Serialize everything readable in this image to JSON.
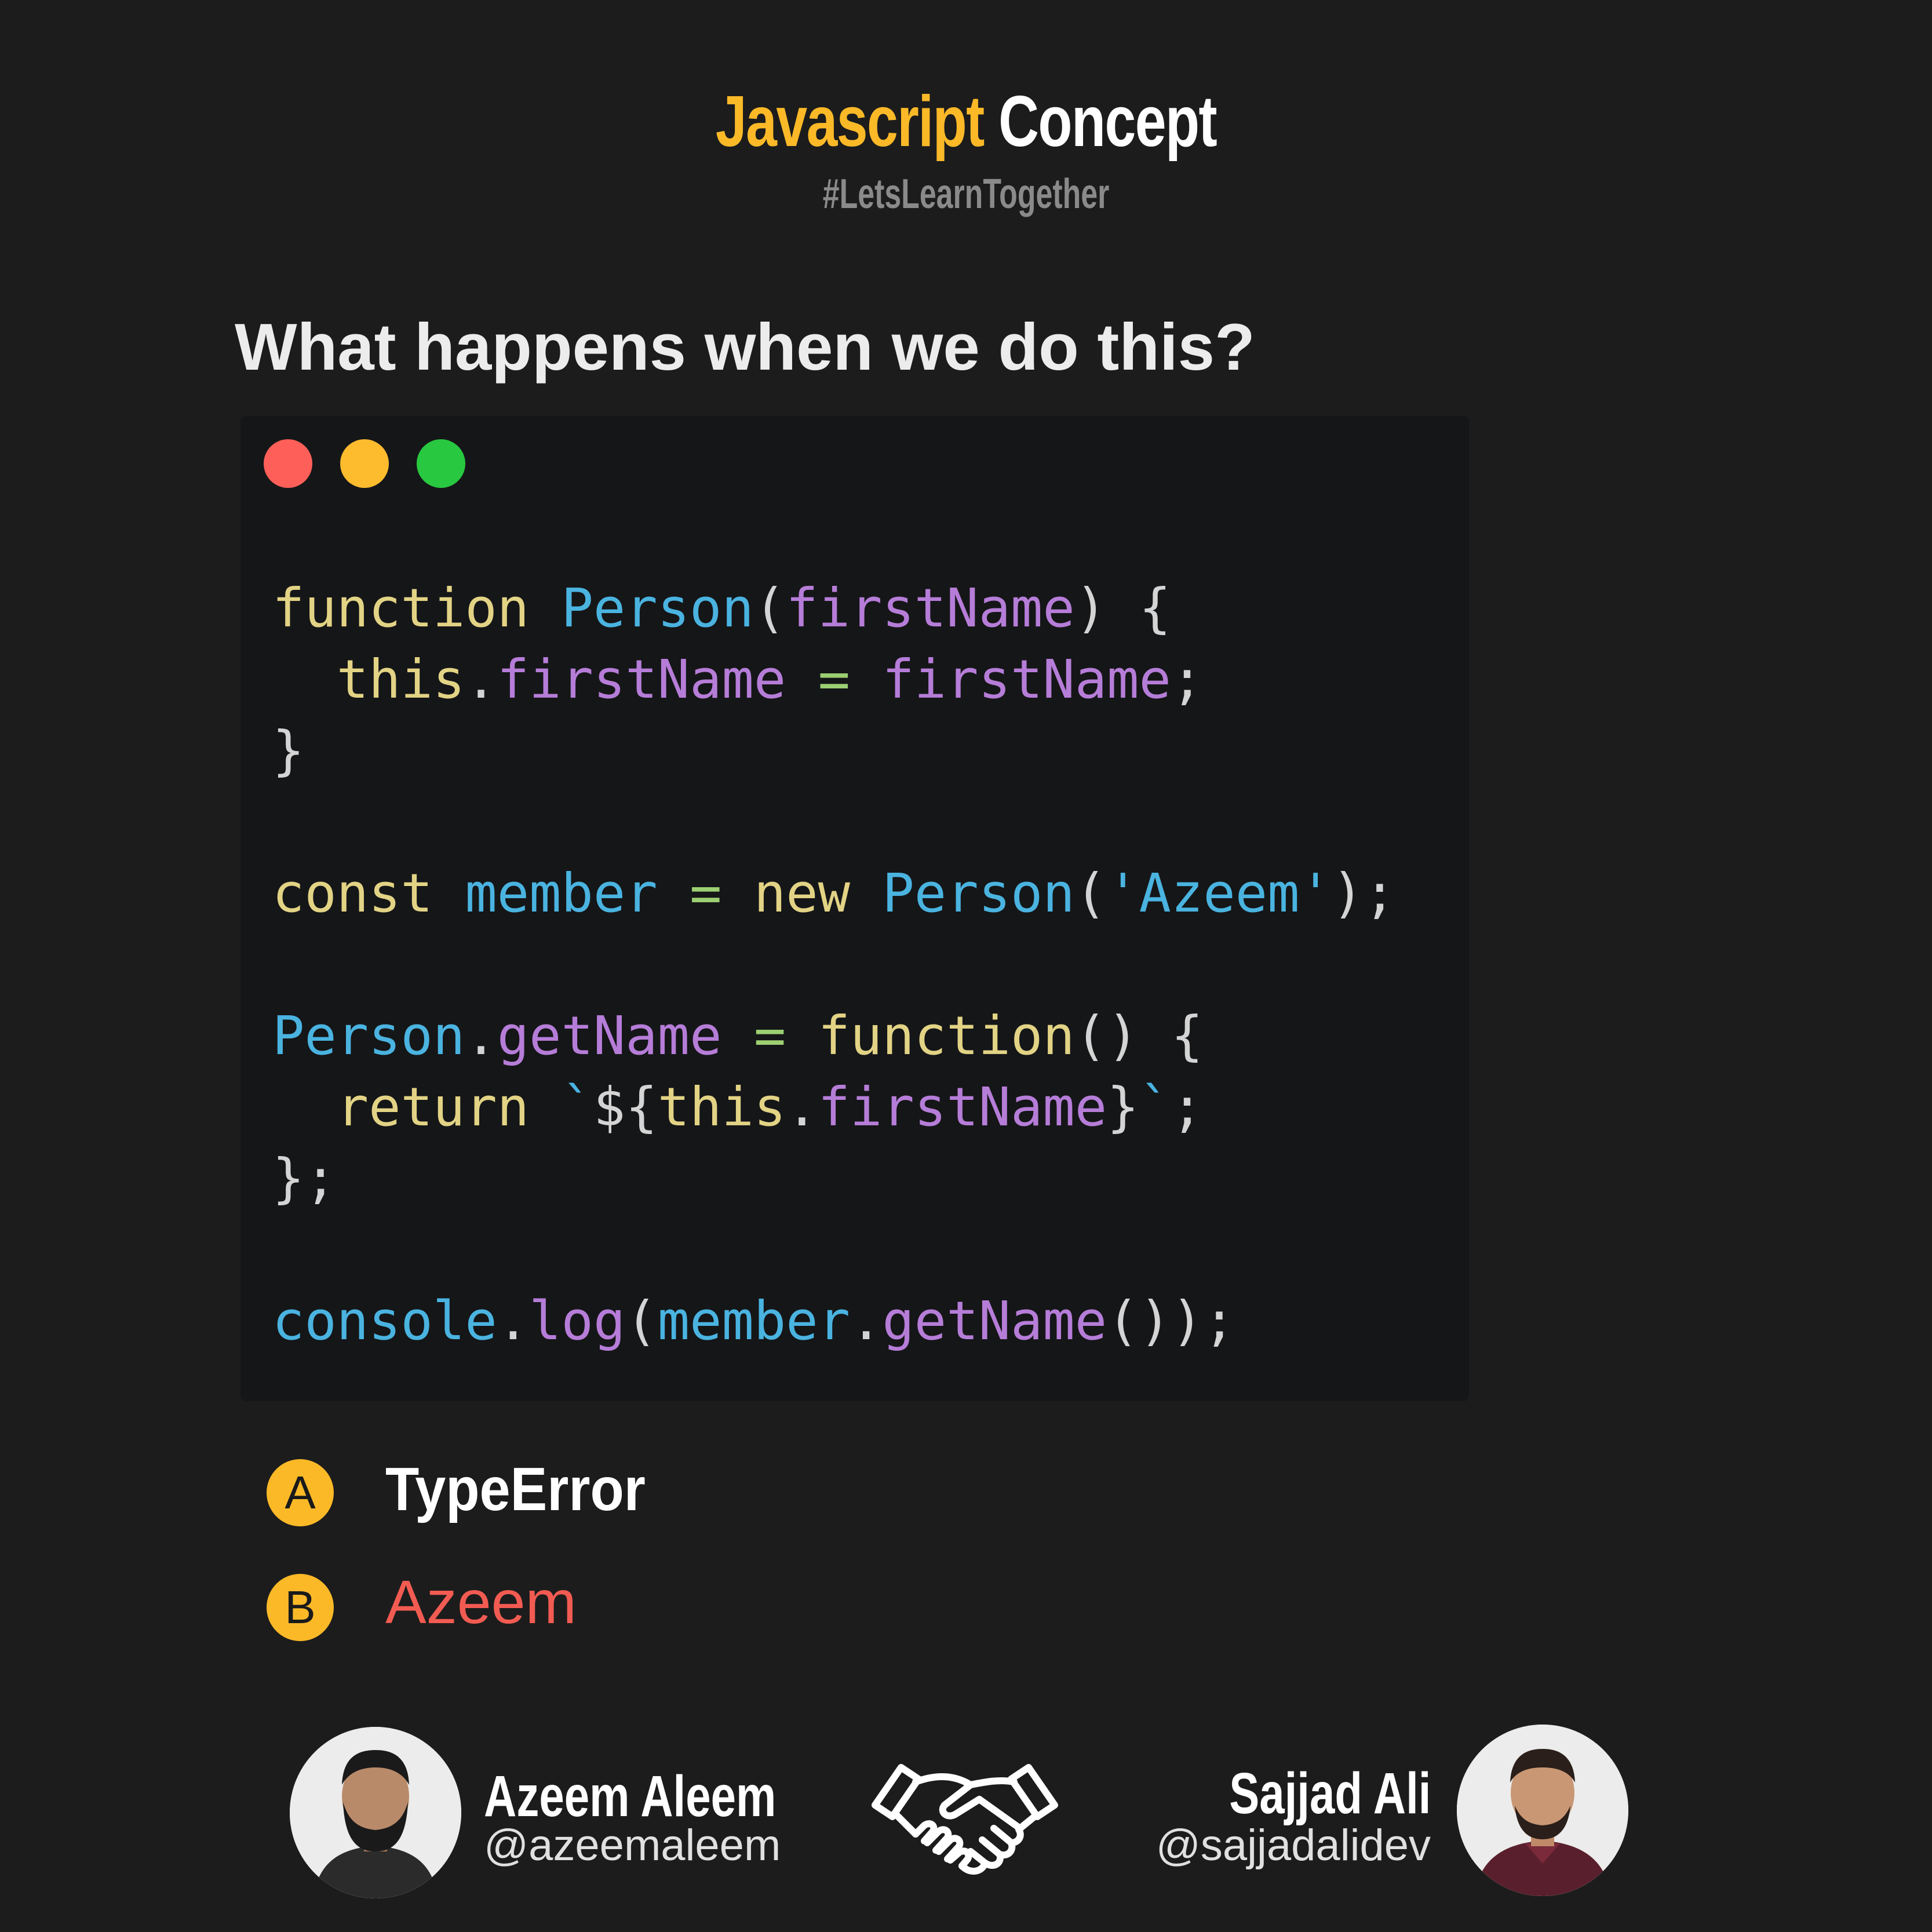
{
  "header": {
    "title_part1": "Javascript",
    "title_part2": "Concept",
    "hashtag": "#LetsLearnTogether"
  },
  "question": "What happens when we do this?",
  "code": {
    "language": "javascript",
    "lines": [
      "function Person(firstName) {",
      "  this.firstName = firstName;",
      "}",
      "",
      "const member = new Person('Azeem');",
      "",
      "Person.getName = function() {",
      "  return `${this.firstName}`;",
      "};",
      "",
      "console.log(member.getName());"
    ],
    "window_dots": [
      "red",
      "yellow",
      "green"
    ]
  },
  "options": [
    {
      "letter": "A",
      "text": "TypeError"
    },
    {
      "letter": "B",
      "text": "Azeem"
    }
  ],
  "authors": {
    "left": {
      "name": "Azeem Aleem",
      "handle": "@azeemaleem"
    },
    "right": {
      "name": "Sajjad Ali",
      "handle": "@sajjadalidev"
    }
  },
  "icons": {
    "collaboration": "handshake-icon"
  },
  "colors": {
    "background": "#1c1c1c",
    "accent_yellow": "#fbb928",
    "answer_red": "#f25b52",
    "code_background": "#151618"
  }
}
